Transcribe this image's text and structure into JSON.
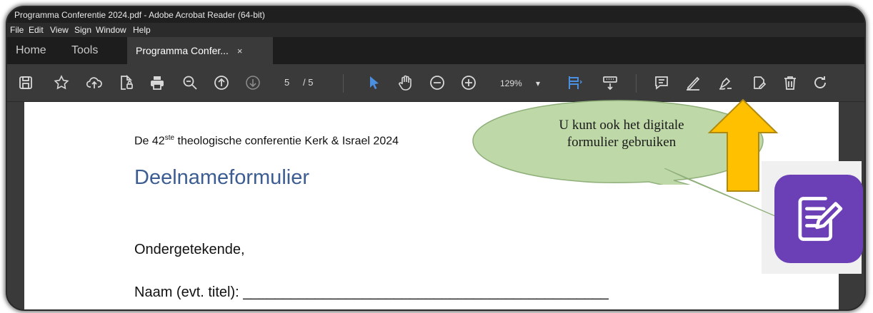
{
  "window": {
    "title": "Programma Conferentie 2024.pdf - Adobe Acrobat Reader (64-bit)"
  },
  "menu": {
    "items": [
      "File",
      "Edit",
      "View",
      "Sign",
      "Window",
      "Help"
    ]
  },
  "tabs": {
    "home": "Home",
    "tools": "Tools",
    "document": "Programma Confer...",
    "close": "×"
  },
  "toolbar": {
    "page_current": "5",
    "page_total": "/ 5",
    "zoom": "129%",
    "zoom_caret": "▾",
    "icons": [
      "save-icon",
      "bookmark-star-icon",
      "upload-cloud-icon",
      "protect-file-icon",
      "print-icon",
      "zoom-search-icon",
      "page-up-icon",
      "page-down-icon",
      "select-cursor-icon",
      "hand-tool-icon",
      "zoom-out-icon",
      "zoom-in-icon",
      "fit-page-icon",
      "scroll-mode-icon",
      "comment-icon",
      "highlight-icon",
      "sign-icon",
      "fill-sign-icon",
      "delete-icon",
      "rotate-icon"
    ]
  },
  "document": {
    "subtitle_prefix": "De 42",
    "subtitle_sup": "ste",
    "subtitle_suffix": " theologische conferentie Kerk & Israel 2024",
    "title": "Deelnameformulier",
    "line1": "Ondergetekende,",
    "line2": "Naam (evt. titel): ______________________________________________"
  },
  "callout": {
    "line1": "U kunt ook het digitale",
    "line2": "formulier gebruiken"
  },
  "colors": {
    "accent_blue": "#4a8fe0",
    "arrow": "#ffc000",
    "bubble": "#bfd8a8",
    "app_icon": "#6b3fb5",
    "title_blue": "#3c5d92"
  }
}
